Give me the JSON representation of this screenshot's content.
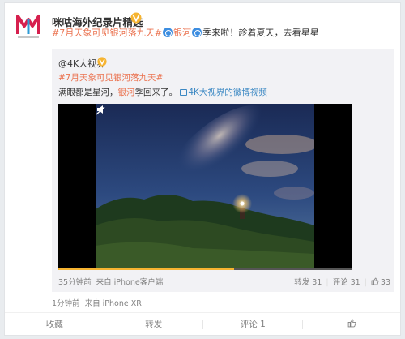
{
  "post": {
    "author": "咪咕海外纪录片精选",
    "text_tag1": "#7月天象可见银河落九天#",
    "text_tag2": "银河",
    "text_rest": "季来啦！趁着夏天，去看星星",
    "time": "1分钟前",
    "source": "来自 iPhone XR"
  },
  "repost": {
    "author": "@4K大视界",
    "tag_line": "#7月天象可见银河落九天#",
    "text_start": "满眼都是星河，",
    "text_link": "银河",
    "text_after": "季回来了。",
    "video_link": "4K大视界的微博视频",
    "video_progress": 0.6,
    "time": "35分钟前",
    "source": "来自 iPhone客户端",
    "repost_label": "转发 31",
    "comment_label": "评论 31",
    "like_count": "33"
  },
  "actions": {
    "favorite": "收藏",
    "forward": "转发",
    "comment": "评论 1"
  },
  "colors": {
    "link": "#eb7350",
    "video_link": "#3b88c3",
    "verified": "#f6b431",
    "progress": "#f6b431"
  }
}
